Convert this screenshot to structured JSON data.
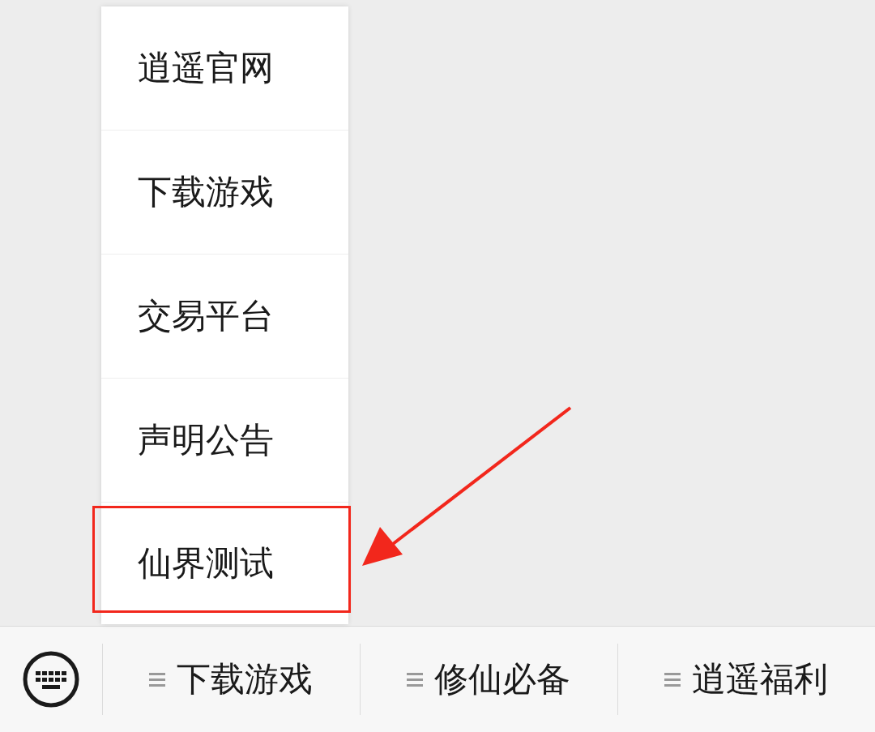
{
  "popup_menu": {
    "items": [
      {
        "label": "逍遥官网",
        "highlighted": false
      },
      {
        "label": "下载游戏",
        "highlighted": false
      },
      {
        "label": "交易平台",
        "highlighted": false
      },
      {
        "label": "声明公告",
        "highlighted": false
      },
      {
        "label": "仙界测试",
        "highlighted": true
      }
    ]
  },
  "bottom_bar": {
    "menus": [
      {
        "label": "下载游戏"
      },
      {
        "label": "修仙必备"
      },
      {
        "label": "逍遥福利"
      }
    ]
  }
}
